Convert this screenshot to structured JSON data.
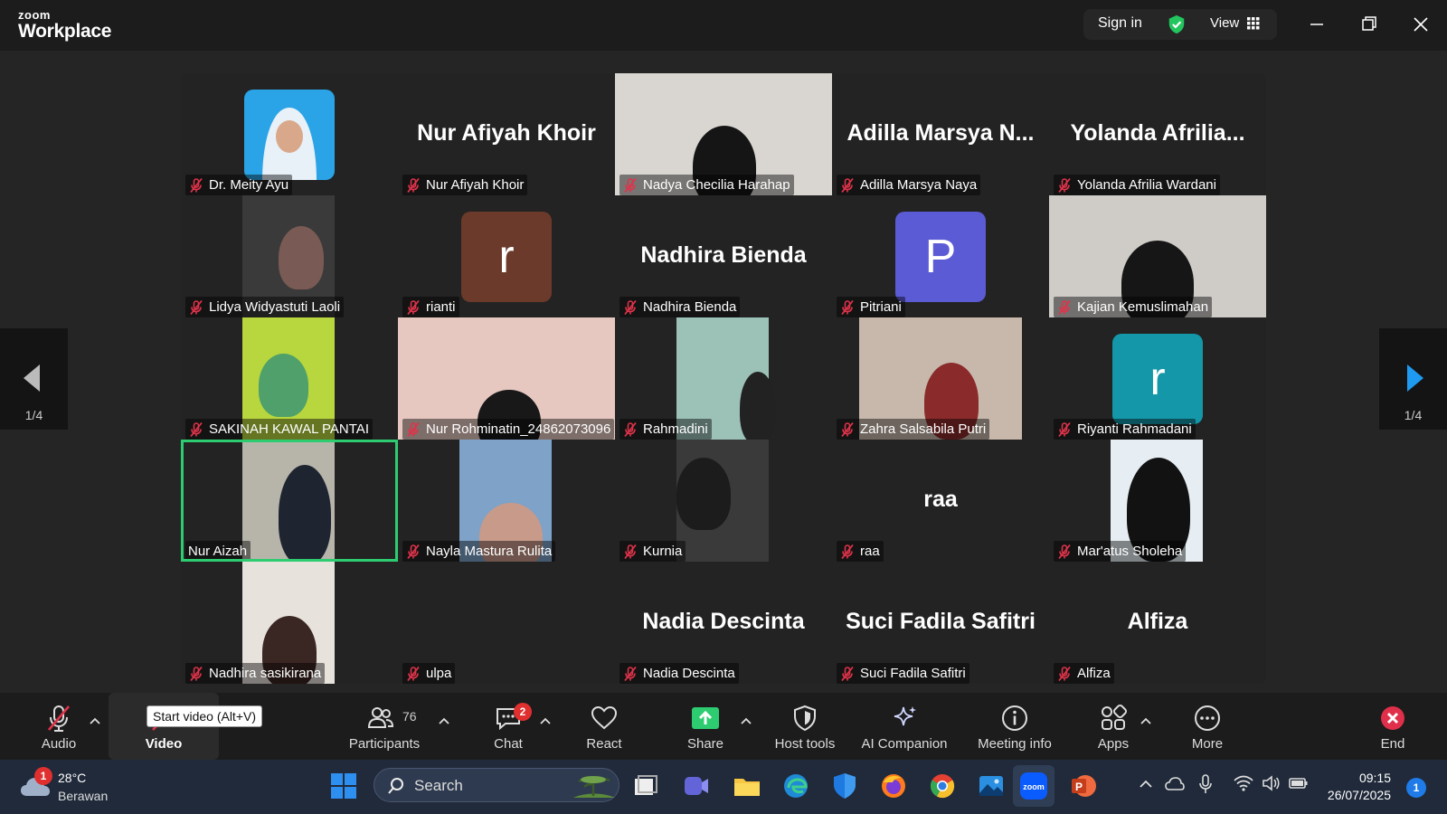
{
  "app": {
    "logo_top": "zoom",
    "logo_bottom": "Workplace"
  },
  "titlebar": {
    "sign_in": "Sign in",
    "view": "View",
    "security_icon": "shield-check-icon",
    "view_icon": "grid-icon"
  },
  "colors": {
    "active_speaker": "#2ecc71",
    "mute": "#e0334a",
    "share": "#2ecc71",
    "end": "#e02f4a",
    "badge": "#e02f2f"
  },
  "gallery": {
    "page_left": "1/4",
    "page_right": "1/4",
    "tiles": [
      {
        "name": "Dr. Meity Ayu",
        "display": "",
        "kind": "photo",
        "muted": true
      },
      {
        "name": "Nur Afiyah Khoir",
        "display": "Nur Afiyah Khoir",
        "kind": "text",
        "muted": true
      },
      {
        "name": "Nadya Checilia Harahap",
        "display": "",
        "kind": "video",
        "muted": true
      },
      {
        "name": "Adilla Marsya Naya",
        "display": "Adilla Marsya N...",
        "kind": "text",
        "muted": true
      },
      {
        "name": "Yolanda Afrilia Wardani",
        "display": "Yolanda Afrilia...",
        "kind": "text",
        "muted": true
      },
      {
        "name": "Lidya Widyastuti Laoli",
        "display": "",
        "kind": "video",
        "muted": true
      },
      {
        "name": "rianti",
        "display": "",
        "kind": "avatar",
        "letter": "r",
        "avatar_color": "#6b3a2a",
        "muted": true
      },
      {
        "name": "Nadhira Bienda",
        "display": "Nadhira Bienda",
        "kind": "text",
        "muted": true
      },
      {
        "name": "Pitriani",
        "display": "",
        "kind": "avatar",
        "letter": "P",
        "avatar_color": "#5b5bd6",
        "muted": true
      },
      {
        "name": "Kajian Kemuslimahan",
        "display": "",
        "kind": "video",
        "muted": true
      },
      {
        "name": "SAKINAH KAWAL PANTAI",
        "display": "",
        "kind": "video",
        "muted": true
      },
      {
        "name": "Nur Rohminatin_24862073096",
        "display": "",
        "kind": "video",
        "muted": true
      },
      {
        "name": "Rahmadini",
        "display": "",
        "kind": "video",
        "muted": true
      },
      {
        "name": "Zahra Salsabila Putri",
        "display": "",
        "kind": "video",
        "muted": true
      },
      {
        "name": "Riyanti Rahmadani",
        "display": "",
        "kind": "avatar",
        "letter": "r",
        "avatar_color": "#1497a8",
        "muted": true
      },
      {
        "name": "Nur Aizah",
        "display": "",
        "kind": "video",
        "muted": false
      },
      {
        "name": "Nayla Mastura Rulita",
        "display": "",
        "kind": "video",
        "muted": true
      },
      {
        "name": "Kurnia",
        "display": "",
        "kind": "video",
        "muted": true
      },
      {
        "name": "raa",
        "display": "raa",
        "kind": "text",
        "muted": true
      },
      {
        "name": "Mar'atus Sholeha",
        "display": "",
        "kind": "video",
        "muted": true
      },
      {
        "name": "Nadhira sasikirana",
        "display": "",
        "kind": "video",
        "muted": true
      },
      {
        "name": "ulpa",
        "display": "",
        "kind": "blank",
        "muted": true
      },
      {
        "name": "Nadia Descinta",
        "display": "Nadia Descinta",
        "kind": "text",
        "muted": true
      },
      {
        "name": "Suci Fadila Safitri",
        "display": "Suci Fadila Safitri",
        "kind": "text",
        "muted": true
      },
      {
        "name": "Alfiza",
        "display": "Alfiza",
        "kind": "text",
        "muted": true
      }
    ]
  },
  "toolbar": {
    "audio": "Audio",
    "video": "Video",
    "tooltip": "Start video (Alt+V)",
    "participants": "Participants",
    "participants_count": "76",
    "chat": "Chat",
    "chat_badge": "2",
    "react": "React",
    "share": "Share",
    "host_tools": "Host tools",
    "ai_companion": "AI Companion",
    "meeting_info": "Meeting info",
    "apps": "Apps",
    "more": "More",
    "end": "End"
  },
  "taskbar": {
    "weather_badge": "1",
    "temperature": "28°C",
    "weather_desc": "Berawan",
    "search_placeholder": "Search",
    "time": "09:15",
    "date": "26/07/2025",
    "notification_count": "1"
  }
}
